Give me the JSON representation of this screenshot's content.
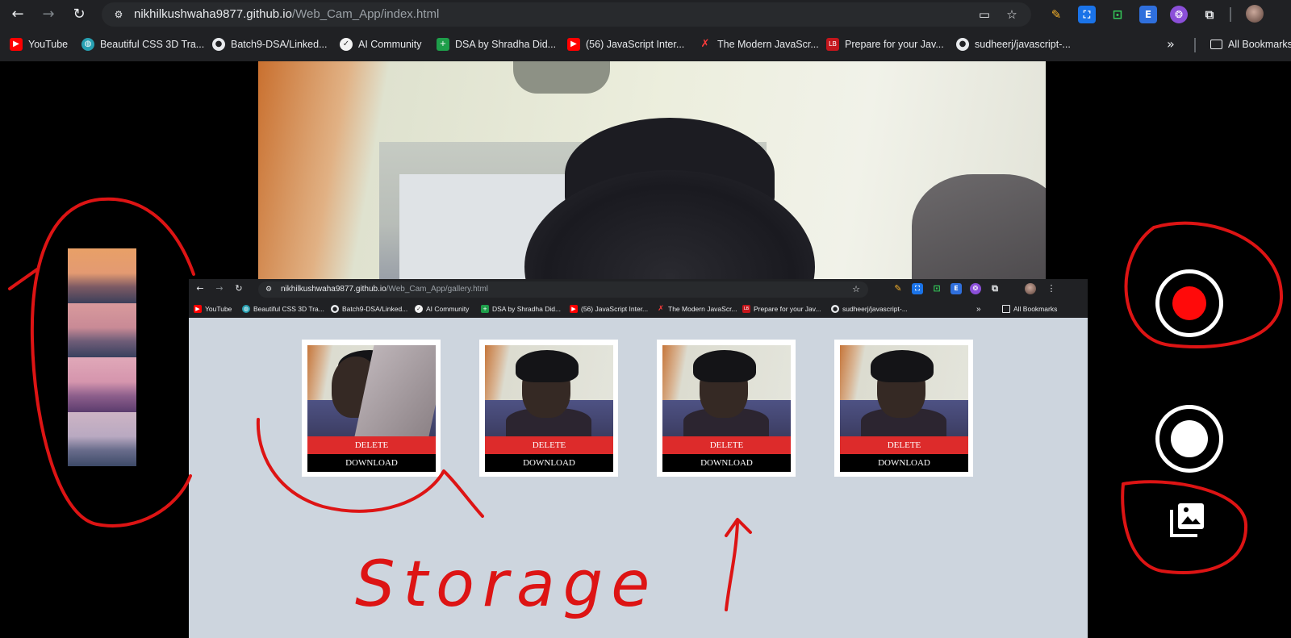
{
  "browser": {
    "url_host": "nikhilkushwaha9877.github.io",
    "url_path": "/Web_Cam_App/index.html",
    "bookmarks": [
      {
        "label": "YouTube",
        "icon": "youtube-icon",
        "color": "#ff0000"
      },
      {
        "label": "Beautiful CSS 3D Tra...",
        "icon": "globe-icon",
        "color": "#27a0b2"
      },
      {
        "label": "Batch9-DSA/Linked...",
        "icon": "github-icon",
        "color": "#e8eaed"
      },
      {
        "label": "AI Community",
        "icon": "ai-community-icon",
        "color": "#f2f2f2"
      },
      {
        "label": "DSA by Shradha Did...",
        "icon": "sheets-icon",
        "color": "#1e9e4a"
      },
      {
        "label": "(56) JavaScript Inter...",
        "icon": "youtube-icon",
        "color": "#ff0000"
      },
      {
        "label": "The Modern JavaScr...",
        "icon": "x-logo-icon",
        "color": "#ff3b3b"
      },
      {
        "label": "Prepare for your Jav...",
        "icon": "lb-logo-icon",
        "color": "#c4161c"
      },
      {
        "label": "sudheerj/javascript-...",
        "icon": "github-icon",
        "color": "#e8eaed"
      }
    ],
    "overflow_label": "»",
    "all_bookmarks_label": "All Bookmarks"
  },
  "gallery_browser": {
    "url_host": "nikhilkushwaha9877.github.io",
    "url_path": "/Web_Cam_App/gallery.html",
    "all_bookmarks_label": "All Bookmarks",
    "cards": [
      {
        "delete_label": "DELETE",
        "download_label": "DOWNLOAD"
      },
      {
        "delete_label": "DELETE",
        "download_label": "DOWNLOAD"
      },
      {
        "delete_label": "DELETE",
        "download_label": "DOWNLOAD"
      },
      {
        "delete_label": "DELETE",
        "download_label": "DOWNLOAD"
      }
    ]
  },
  "annotation": {
    "text": "Storage",
    "color": "#dd1414"
  },
  "colors": {
    "chrome_bg": "#202124",
    "record_red": "#ff0a0a",
    "delete_red": "#dd2b2b",
    "gallery_bg": "#cdd5de"
  }
}
